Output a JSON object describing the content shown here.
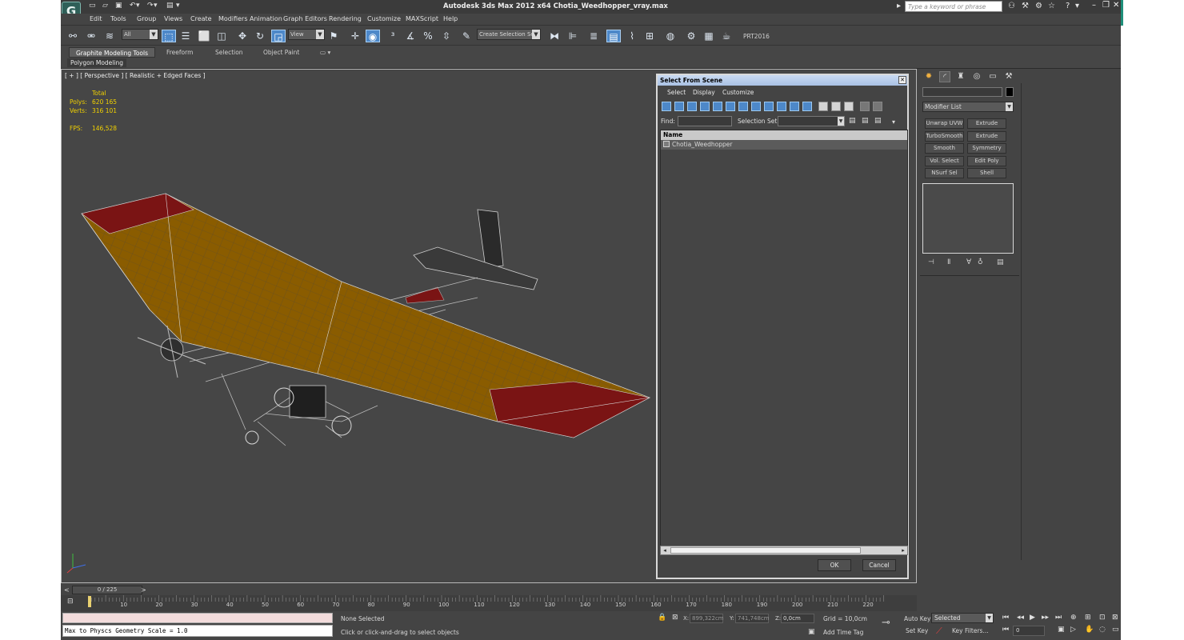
{
  "window": {
    "title": "Autodesk 3ds Max  2012 x64     Chotia_Weedhopper_vray.max",
    "search_placeholder": "Type a keyword or phrase",
    "logo_letter": "G"
  },
  "menu": [
    "Edit",
    "Tools",
    "Group",
    "Views",
    "Create",
    "Modifiers",
    "Animation",
    "Graph Editors",
    "Rendering",
    "Customize",
    "MAXScript",
    "Help"
  ],
  "toolbar": {
    "filter_value": "All",
    "ref_coord_value": "View",
    "selection_set_value": "Create Selection Se",
    "plugin_label": "PRT2016",
    "active_color": "#4d88c9"
  },
  "ribbon": {
    "tabs": [
      "Graphite Modeling Tools",
      "Freeform",
      "Selection",
      "Object Paint"
    ],
    "sub_label": "Polygon Modeling"
  },
  "viewport": {
    "label": "[ + ] [ Perspective ] [ Realistic + Edged Faces ]",
    "stats_header": "Total",
    "polys_label": "Polys:",
    "polys_value": "620 165",
    "verts_label": "Verts:",
    "verts_value": "316 101",
    "fps_label": "FPS:",
    "fps_value": "146,528",
    "stats_color": "#f0d000"
  },
  "dialog": {
    "title": "Select From Scene",
    "menus": [
      "Select",
      "Display",
      "Customize"
    ],
    "find_label": "Find:",
    "selection_set_label": "Selection Set:",
    "column_header": "Name",
    "rows": [
      "Chotia_Weedhopper"
    ],
    "ok": "OK",
    "cancel": "Cancel"
  },
  "command_panel": {
    "modifier_list": "Modifier List",
    "buttons": [
      "Unwrap UVW",
      "Extrude",
      "TurboSmooth",
      "Extrude",
      "Smooth",
      "Symmetry",
      "Vol. Select",
      "Edit Poly",
      "NSurf Sel",
      "Shell"
    ]
  },
  "timeline": {
    "slider": "0 / 225",
    "tick_labels": [
      "10",
      "20",
      "30",
      "40",
      "50",
      "60",
      "70",
      "80",
      "90",
      "100",
      "110",
      "120",
      "130",
      "140",
      "150",
      "160",
      "170",
      "180",
      "190",
      "200",
      "210",
      "220"
    ]
  },
  "status": {
    "listener_output": "Max to Physcs Geometry Scale = 1.0",
    "selection_status": "None Selected",
    "prompt": "Click or click-and-drag to select objects",
    "x_label": "X:",
    "x_value": "899,322cm",
    "y_label": "Y:",
    "y_value": "741,748cm",
    "z_label": "Z:",
    "z_value": "0,0cm",
    "grid": "Grid = 10,0cm",
    "add_time_tag": "Add Time Tag",
    "auto_key": "Auto Key",
    "set_key": "Set Key",
    "key_mode": "Selected",
    "key_filters": "Key Filters...",
    "frame": "0"
  }
}
